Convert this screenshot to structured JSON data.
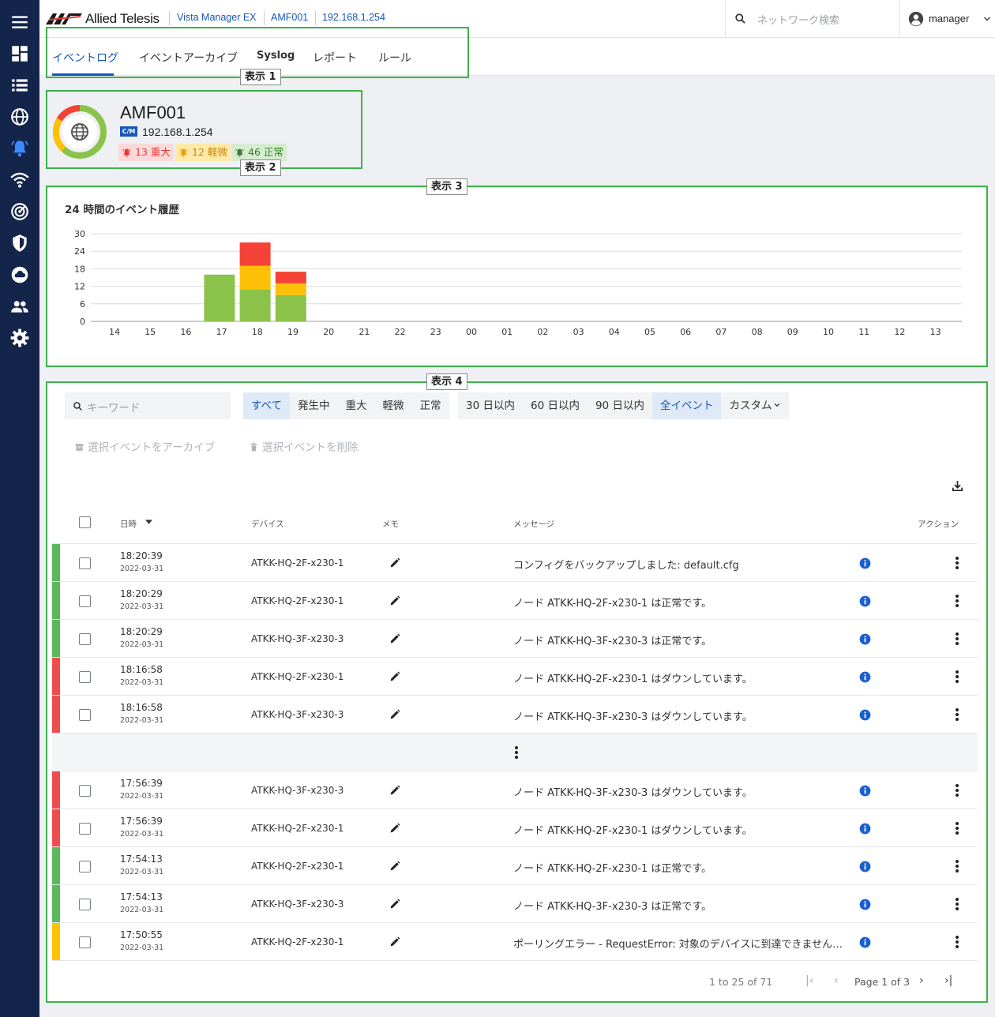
{
  "brand": {
    "logo_text": "Allied Telesis",
    "brand_color": "#14254b",
    "accent": "#1657b8"
  },
  "breadcrumb": [
    "Vista Manager EX",
    "AMF001",
    "192.168.1.254"
  ],
  "search": {
    "placeholder": "ネットワーク検索"
  },
  "user": {
    "name": "manager"
  },
  "sidebar": {
    "items": [
      "menu-icon",
      "dashboard-icon",
      "list-icon",
      "globe-icon",
      "bell-icon",
      "wifi-icon",
      "radar-icon",
      "shield-icon",
      "cloud-icon",
      "users-icon",
      "gear-icon"
    ],
    "active": "bell-icon"
  },
  "tabs": [
    {
      "label": "イベントログ",
      "active": true
    },
    {
      "label": "イベントアーカイブ",
      "active": false
    },
    {
      "label": "Syslog",
      "active": false
    },
    {
      "label": "レポート",
      "active": false
    },
    {
      "label": "ルール",
      "active": false
    }
  ],
  "callouts": [
    "表示 1",
    "表示 2",
    "表示 3",
    "表示 4"
  ],
  "device": {
    "name": "AMF001",
    "badge": "C/M",
    "ip": "192.168.1.254",
    "counts": [
      {
        "label": "13 重大",
        "color": "#f44336"
      },
      {
        "label": "12 軽微",
        "color": "#ffc107"
      },
      {
        "label": "46 正常",
        "color": "#8bc34a"
      }
    ]
  },
  "chart_data": {
    "type": "bar",
    "stacked": true,
    "title": "24 時間のイベント履歴",
    "categories": [
      "14",
      "15",
      "16",
      "17",
      "18",
      "19",
      "20",
      "21",
      "22",
      "23",
      "00",
      "01",
      "02",
      "03",
      "04",
      "05",
      "06",
      "07",
      "08",
      "09",
      "10",
      "11",
      "12",
      "13"
    ],
    "series": [
      {
        "color": "#8bc34a",
        "values": [
          0,
          0,
          16,
          11,
          9,
          0,
          0,
          0,
          0,
          0,
          0,
          0,
          0,
          0,
          0,
          0,
          0,
          0,
          0,
          0,
          0,
          0,
          0,
          0
        ]
      },
      {
        "color": "#ffc107",
        "values": [
          0,
          0,
          0,
          8,
          4,
          0,
          0,
          0,
          0,
          0,
          0,
          0,
          0,
          0,
          0,
          0,
          0,
          0,
          0,
          0,
          0,
          0,
          0,
          0
        ]
      },
      {
        "color": "#f44336",
        "values": [
          0,
          0,
          0,
          8,
          4,
          0,
          0,
          0,
          0,
          0,
          0,
          0,
          0,
          0,
          0,
          0,
          0,
          0,
          0,
          0,
          0,
          0,
          0,
          0
        ]
      }
    ],
    "yticks": [
      0,
      6,
      12,
      18,
      24,
      30
    ],
    "ylim": [
      0,
      30
    ],
    "grid": true
  },
  "filters": {
    "keyword_placeholder": "キーワード",
    "severity": [
      {
        "label": "すべて",
        "selected": true
      },
      {
        "label": "発生中",
        "selected": false
      },
      {
        "label": "重大",
        "selected": false
      },
      {
        "label": "軽微",
        "selected": false
      },
      {
        "label": "正常",
        "selected": false
      }
    ],
    "period": [
      {
        "label": "30 日以内",
        "selected": false
      },
      {
        "label": "60 日以内",
        "selected": false
      },
      {
        "label": "90 日以内",
        "selected": false
      },
      {
        "label": "全イベント",
        "selected": true
      },
      {
        "label": "カスタム",
        "selected": false
      }
    ]
  },
  "bulk_actions": {
    "archive": "選択イベントをアーカイブ",
    "delete": "選択イベントを削除"
  },
  "table": {
    "headers": {
      "datetime": "日時",
      "device": "デバイス",
      "memo": "メモ",
      "message": "メッセージ",
      "action": "アクション"
    },
    "rows_top": [
      {
        "severity_color": "#5cb85c",
        "time": "18:20:39",
        "date": "2022-03-31",
        "device": "ATKK-HQ-2F-x230-1",
        "message": "コンフィグをバックアップしました: default.cfg"
      },
      {
        "severity_color": "#5cb85c",
        "time": "18:20:29",
        "date": "2022-03-31",
        "device": "ATKK-HQ-2F-x230-1",
        "message": "ノード ATKK-HQ-2F-x230-1 は正常です。"
      },
      {
        "severity_color": "#5cb85c",
        "time": "18:20:29",
        "date": "2022-03-31",
        "device": "ATKK-HQ-3F-x230-3",
        "message": "ノード ATKK-HQ-3F-x230-3 は正常です。"
      },
      {
        "severity_color": "#ef4d4d",
        "time": "18:16:58",
        "date": "2022-03-31",
        "device": "ATKK-HQ-2F-x230-1",
        "message": "ノード ATKK-HQ-2F-x230-1 はダウンしています。"
      },
      {
        "severity_color": "#ef4d4d",
        "time": "18:16:58",
        "date": "2022-03-31",
        "device": "ATKK-HQ-3F-x230-3",
        "message": "ノード ATKK-HQ-3F-x230-3 はダウンしています。"
      }
    ],
    "rows_bottom": [
      {
        "severity_color": "#ef4d4d",
        "time": "17:56:39",
        "date": "2022-03-31",
        "device": "ATKK-HQ-3F-x230-3",
        "message": "ノード ATKK-HQ-3F-x230-3 はダウンしています。"
      },
      {
        "severity_color": "#ef4d4d",
        "time": "17:56:39",
        "date": "2022-03-31",
        "device": "ATKK-HQ-2F-x230-1",
        "message": "ノード ATKK-HQ-2F-x230-1 はダウンしています。"
      },
      {
        "severity_color": "#5cb85c",
        "time": "17:54:13",
        "date": "2022-03-31",
        "device": "ATKK-HQ-2F-x230-1",
        "message": "ノード ATKK-HQ-2F-x230-1 は正常です。"
      },
      {
        "severity_color": "#5cb85c",
        "time": "17:54:13",
        "date": "2022-03-31",
        "device": "ATKK-HQ-3F-x230-3",
        "message": "ノード ATKK-HQ-3F-x230-3 は正常です。"
      },
      {
        "severity_color": "#ffc107",
        "time": "17:50:55",
        "date": "2022-03-31",
        "device": "ATKK-HQ-2F-x230-1",
        "message": "ポーリングエラー - RequestError: 対象のデバイスに到達できません。..."
      }
    ]
  },
  "pagination": {
    "range": "1 to 25 of 71",
    "page": "Page 1 of 3"
  }
}
